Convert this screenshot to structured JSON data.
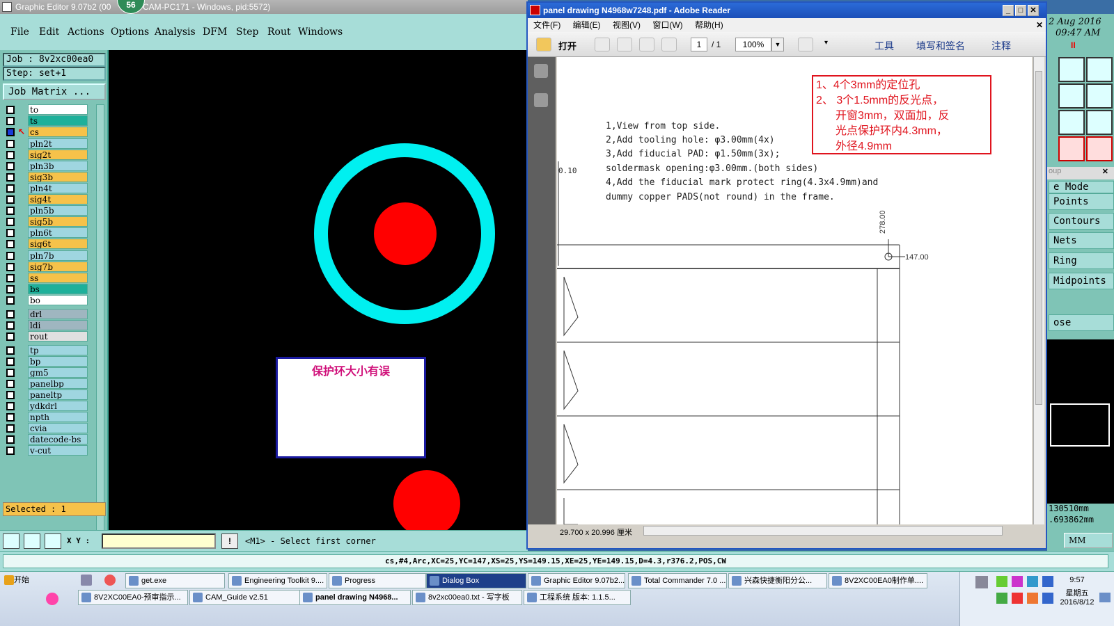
{
  "genesis": {
    "title": "Graphic Editor 9.07b2 (00",
    "title_rest": "CAM-PC171 - Windows, pid:5572)",
    "badge": "56",
    "menu": [
      "File",
      "Edit",
      "Actions",
      "Options",
      "Analysis",
      "DFM",
      "Step",
      "Rout",
      "Windows"
    ],
    "job": "Job : 8v2xc00ea0",
    "step": "Step: set+1",
    "job_matrix": "Job Matrix ...",
    "layers": [
      {
        "name": "to",
        "color": "#ffffff"
      },
      {
        "name": "ts",
        "color": "#1eb09a"
      },
      {
        "name": "cs",
        "color": "#f6c24a"
      },
      {
        "name": "pln2t",
        "color": "#9fd6e0"
      },
      {
        "name": "sig2t",
        "color": "#f6c24a"
      },
      {
        "name": "pln3b",
        "color": "#9fd6e0"
      },
      {
        "name": "sig3b",
        "color": "#f6c24a"
      },
      {
        "name": "pln4t",
        "color": "#9fd6e0"
      },
      {
        "name": "sig4t",
        "color": "#f6c24a"
      },
      {
        "name": "pln5b",
        "color": "#9fd6e0"
      },
      {
        "name": "sig5b",
        "color": "#f6c24a"
      },
      {
        "name": "pln6t",
        "color": "#9fd6e0"
      },
      {
        "name": "sig6t",
        "color": "#f6c24a"
      },
      {
        "name": "pln7b",
        "color": "#9fd6e0"
      },
      {
        "name": "sig7b",
        "color": "#f6c24a"
      },
      {
        "name": "ss",
        "color": "#f6c24a"
      },
      {
        "name": "bs",
        "color": "#1eb09a"
      },
      {
        "name": "bo",
        "color": "#ffffff"
      },
      {
        "name": "drl",
        "color": "#9fb6c0"
      },
      {
        "name": "ldi",
        "color": "#9fb6c0"
      },
      {
        "name": "rout",
        "color": "#e0e0e0"
      },
      {
        "name": "tp",
        "color": "#9fd6e0"
      },
      {
        "name": "bp",
        "color": "#9fd6e0"
      },
      {
        "name": "gm5",
        "color": "#9fd6e0"
      },
      {
        "name": "panelbp",
        "color": "#9fd6e0"
      },
      {
        "name": "paneltp",
        "color": "#9fd6e0"
      },
      {
        "name": "ydkdrl",
        "color": "#9fd6e0"
      },
      {
        "name": "npth",
        "color": "#9fd6e0"
      },
      {
        "name": "cvia",
        "color": "#9fd6e0"
      },
      {
        "name": "datecode-bs",
        "color": "#9fd6e0"
      },
      {
        "name": "v-cut",
        "color": "#9fd6e0"
      }
    ],
    "selected": "Selected : 1",
    "canvas_note": "保护环大小有误",
    "xy_label": "X Y :",
    "status_message": "<M1> - Select first corner",
    "info": "cs,#4,Arc,XC=25,YC=147,XS=25,YS=149.15,XE=25,YE=149.15,D=4.3,r376.2,POS,CW",
    "right": {
      "date": "2 Aug 2016",
      "time": "09:47 AM",
      "group_close": "oup",
      "modes": [
        "e Mode",
        "Points",
        "Contours",
        "Nets",
        "Ring",
        "Midpoints"
      ],
      "close_label": "ose",
      "coord1": "130510mm",
      "coord2": ".693862mm",
      "units": "MM"
    }
  },
  "reader": {
    "title": "panel drawing N4968w7248.pdf - Adobe Reader",
    "menu": [
      "文件(F)",
      "编辑(E)",
      "视图(V)",
      "窗口(W)",
      "帮助(H)"
    ],
    "open_label": "打开",
    "page_value": "1",
    "page_total": "/ 1",
    "zoom": "100%",
    "tools": [
      "工具",
      "填写和签名",
      "注释"
    ],
    "size": "29.700 x 20.996 厘米",
    "red_notes": [
      "1、4个3mm的定位孔",
      "2、 3个1.5mm的反光点，",
      "开窗3mm，双面加，反",
      "光点保护环内4.3mm，",
      "外径4.9mm"
    ],
    "notes": [
      "1,View from top side.",
      "2,Add tooling hole:  φ3.00mm(4x)",
      "3,Add fiducial PAD:  φ1.50mm(3x);",
      "  soldermask opening:φ3.00mm.(both sides)",
      "4,Add the fiducial mark protect ring(4.3x4.9mm)and",
      "  dummy copper PADS(not round) in the frame."
    ],
    "dim_010": "0.10",
    "dim_278": "278.00",
    "dim_147": "147.00"
  },
  "taskbar": {
    "start": "开始",
    "row1": [
      "get.exe",
      "Engineering Toolkit 9....",
      "Progress",
      "Dialog Box",
      "Graphic Editor 9.07b2...",
      "Total Commander 7.0 ...",
      "兴森快捷衡阳分公...",
      "8V2XC00EA0制作单...."
    ],
    "row2": [
      "8V2XC00EA0-预审指示...",
      "CAM_Guide v2.51",
      "panel drawing N4968...",
      "8v2xc00ea0.txt - 写字板",
      "工程系统  版本: 1.1.5..."
    ],
    "clock": "9:57",
    "weekday": "星期五",
    "date": "2016/8/12"
  }
}
